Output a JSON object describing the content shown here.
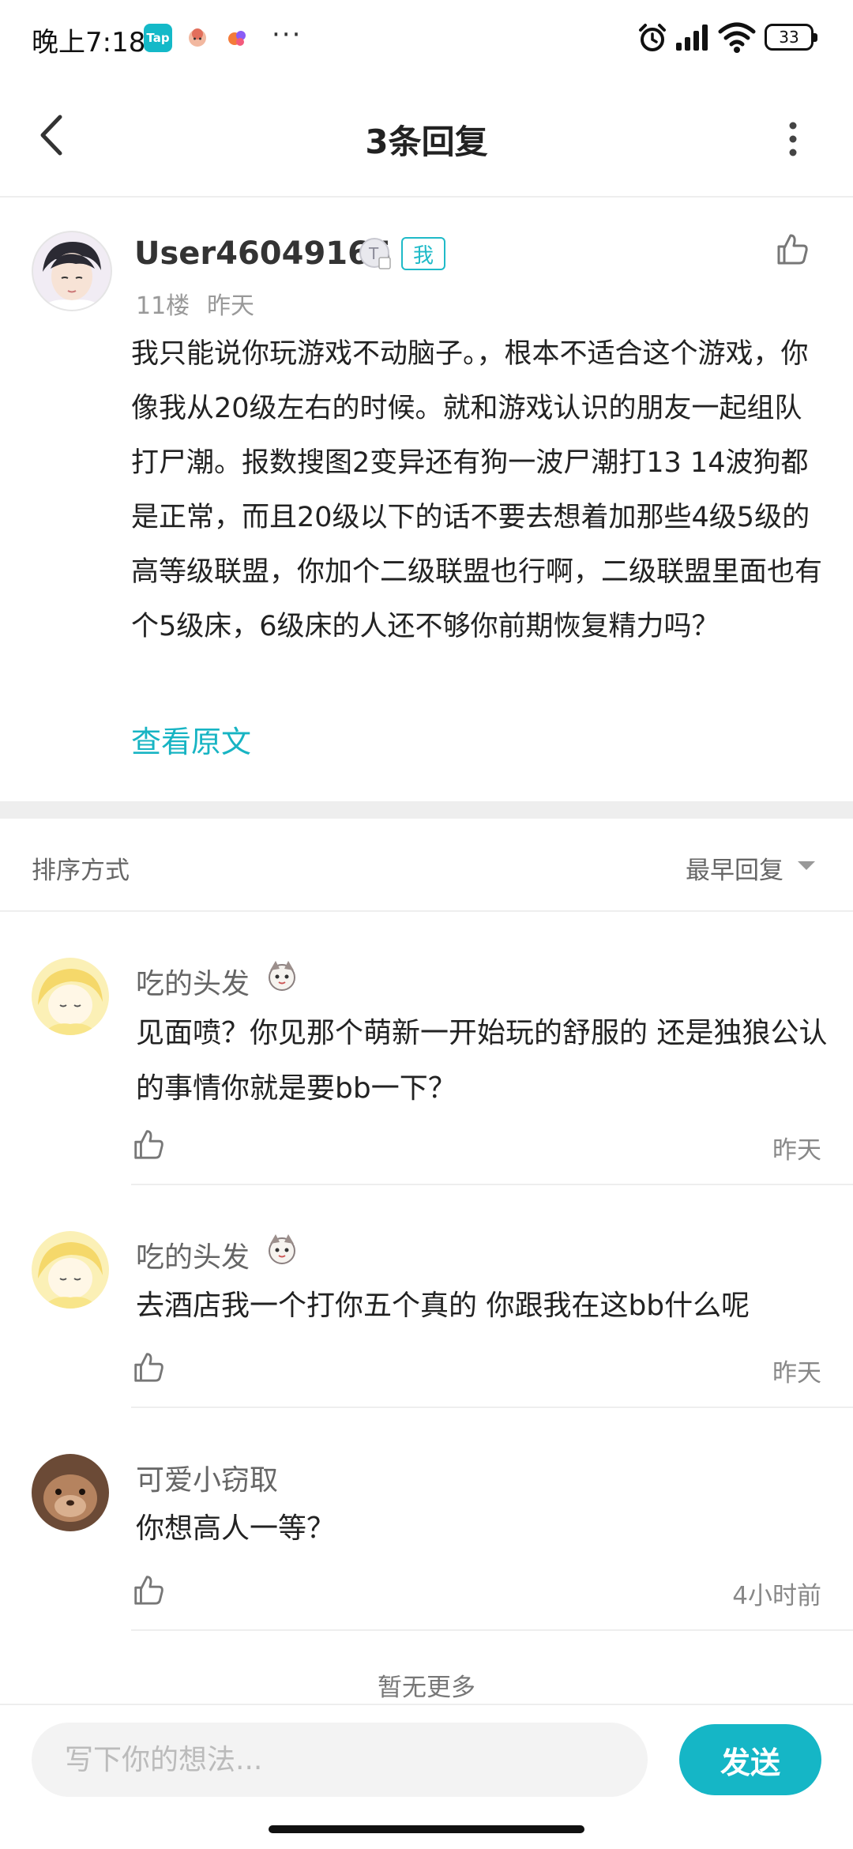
{
  "status_bar": {
    "time": "晚上7:18",
    "tap_badge": "Tap",
    "more_indicator": "···",
    "battery": "33"
  },
  "header": {
    "title": "3条回复",
    "back_icon": "chevron-left-icon",
    "more_icon": "vertical-dots-icon"
  },
  "post": {
    "username": "User46049165",
    "me_badge": "我",
    "floor": "11楼",
    "time": "昨天",
    "content": "我只能说你玩游戏不动脑子。，根本不适合这个游戏，你像我从20级左右的时候。就和游戏认识的朋友一起组队打尸潮。报数搜图2变异还有狗一波尸潮打13 14波狗都是正常，而且20级以下的话不要去想着加那些4级5级的高等级联盟，你加个二级联盟也行啊，二级联盟里面也有个5级床，6级床的人还不够你前期恢复精力吗？",
    "view_original": "查看原文"
  },
  "sort": {
    "label": "排序方式",
    "value": "最早回复"
  },
  "replies": [
    {
      "name": "吃的头发",
      "text": "见面喷？你见那个萌新一开始玩的舒服的 还是独狼公认的事情你就是要bb一下？",
      "time": "昨天"
    },
    {
      "name": "吃的头发",
      "text": "去酒店我一个打你五个真的 你跟我在这bb什么呢",
      "time": "昨天"
    },
    {
      "name": "可爱小窃取",
      "text": "你想高人一等？",
      "time": "4小时前"
    }
  ],
  "footer": {
    "no_more": "暂无更多",
    "input_placeholder": "写下你的想法...",
    "send_label": "发送"
  },
  "colors": {
    "accent": "#15b6c6",
    "divider": "#eeeeee",
    "muted_text": "#999999"
  }
}
